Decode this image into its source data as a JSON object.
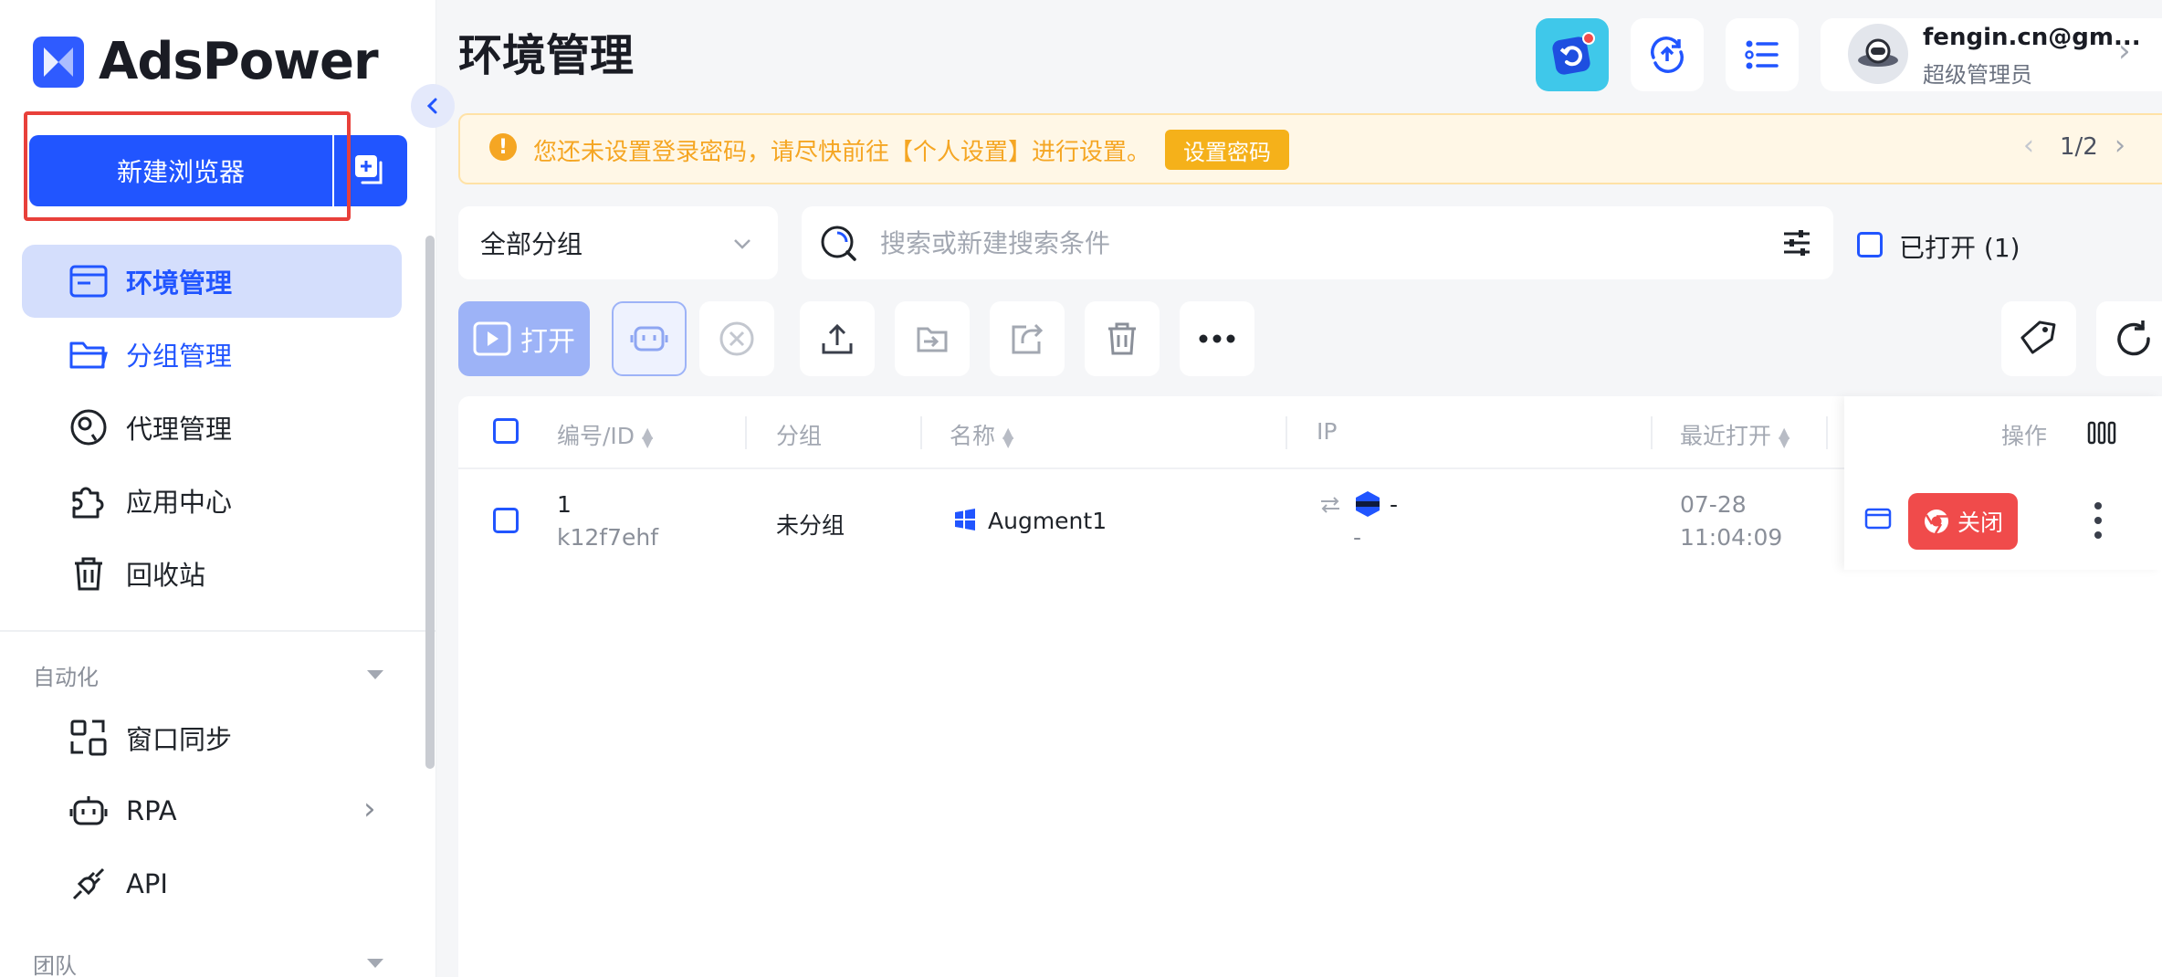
{
  "app": {
    "name": "AdsPower"
  },
  "sidebar": {
    "new_browser_label": "新建浏览器",
    "items": [
      {
        "label": "环境管理",
        "icon": "browser-window-icon",
        "active": true
      },
      {
        "label": "分组管理",
        "icon": "folder-icon"
      },
      {
        "label": "代理管理",
        "icon": "globe-proxy-icon"
      },
      {
        "label": "应用中心",
        "icon": "puzzle-icon"
      },
      {
        "label": "回收站",
        "icon": "trash-icon"
      }
    ],
    "automation_title": "自动化",
    "automation_items": [
      {
        "label": "窗口同步",
        "icon": "window-sync-icon"
      },
      {
        "label": "RPA",
        "icon": "robot-icon"
      },
      {
        "label": "API",
        "icon": "plug-icon"
      }
    ],
    "team_title": "团队"
  },
  "header": {
    "title": "环境管理",
    "user_email": "fengin.cn@gm...",
    "user_role": "超级管理员"
  },
  "notice": {
    "text": "您还未设置登录密码，请尽快前往【个人设置】进行设置。",
    "action_label": "设置密码",
    "page": "1/2"
  },
  "filters": {
    "group_value": "全部分组",
    "search_placeholder": "搜索或新建搜索条件",
    "opened_label": "已打开 (1)"
  },
  "toolbar": {
    "open_label": "打开"
  },
  "table": {
    "columns": [
      "编号/ID",
      "分组",
      "名称",
      "IP",
      "最近打开",
      "操作"
    ],
    "rows": [
      {
        "number": "1",
        "id": "k12f7ehf",
        "group": "未分组",
        "name": "Augment1",
        "ip_main": "-",
        "ip_sub": "-",
        "last_open_date": "07-28",
        "last_open_time": "11:04:09",
        "action_label": "关闭"
      }
    ]
  },
  "colors": {
    "primary": "#2155ff",
    "warning": "#f5a623",
    "danger": "#f04b4b",
    "highlight": "#e8403a"
  }
}
